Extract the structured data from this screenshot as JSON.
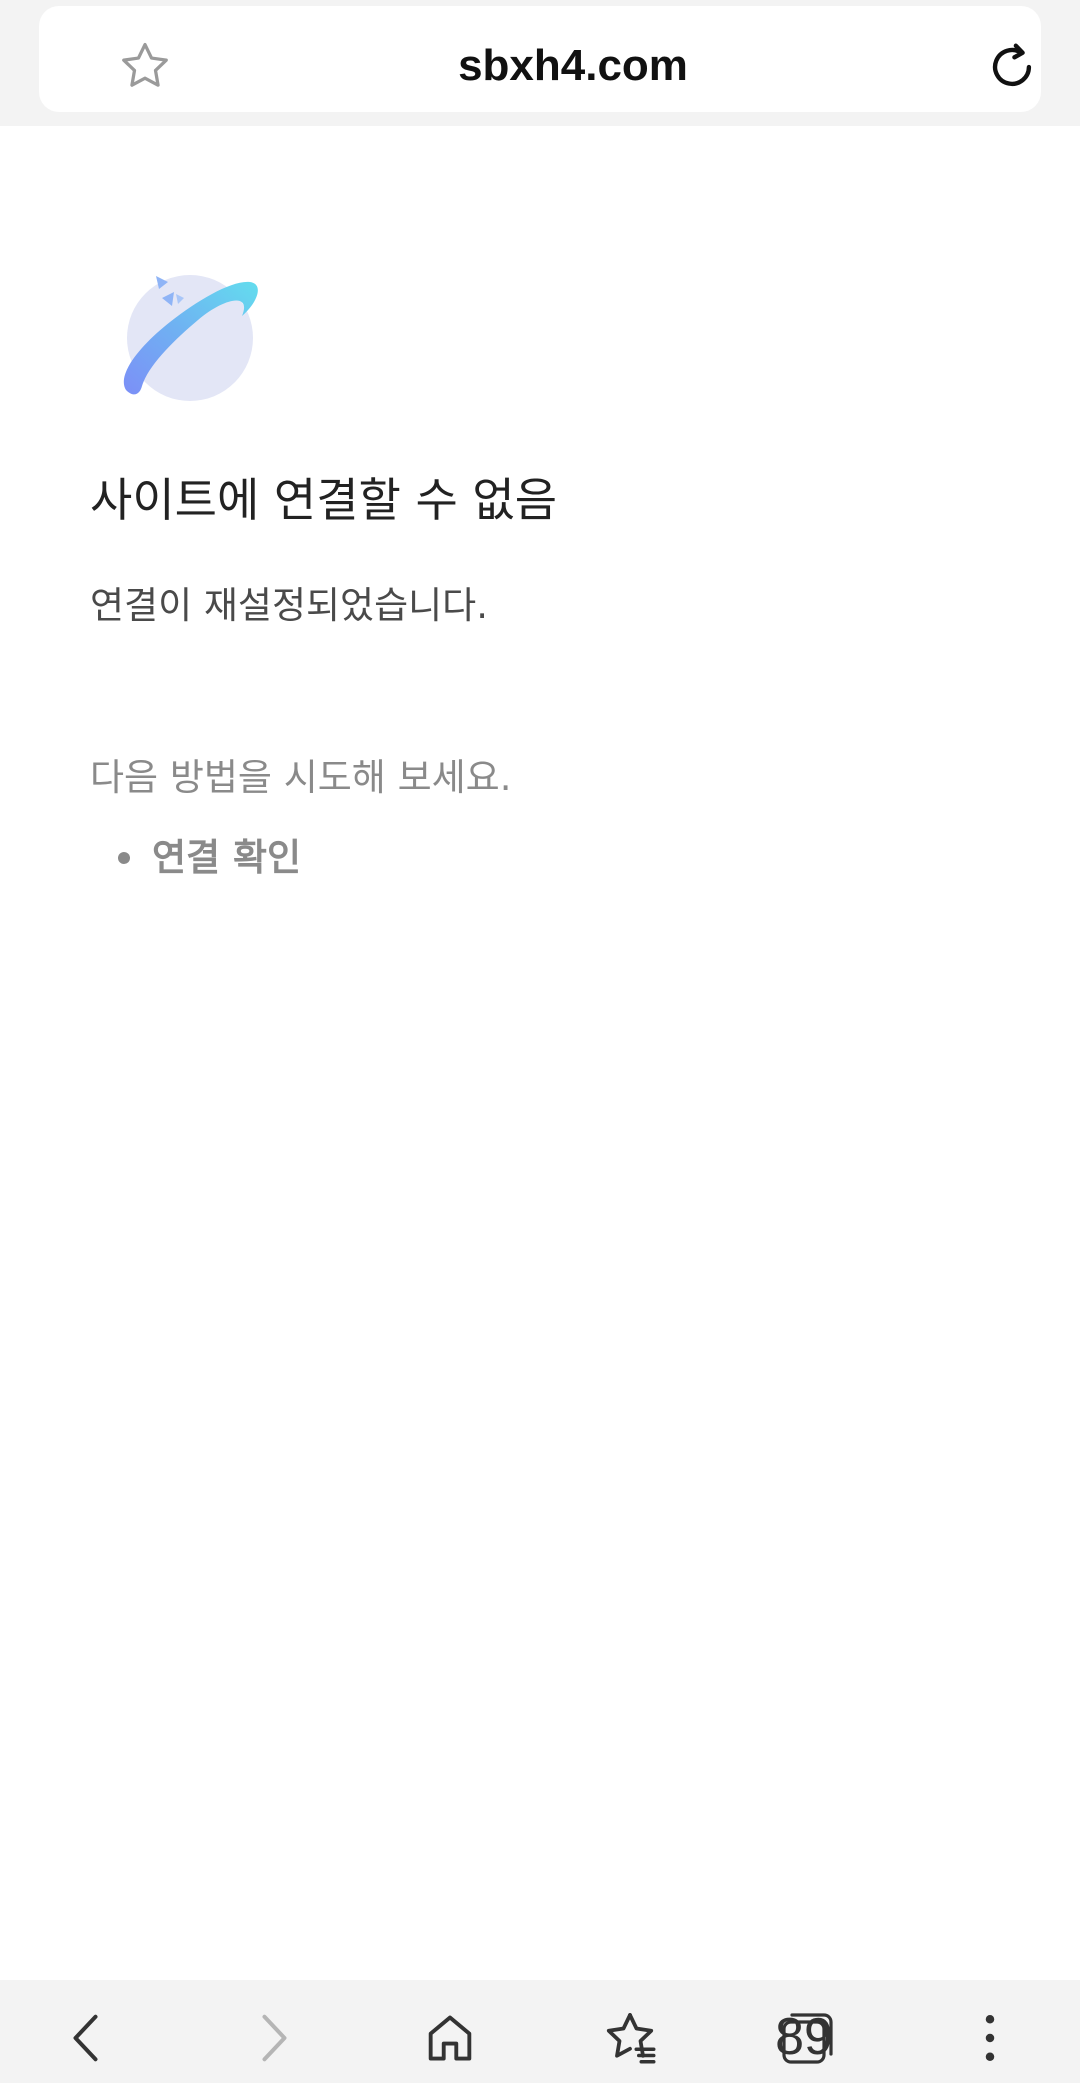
{
  "address_bar": {
    "url": "sbxh4.com",
    "bookmark_icon": "star-outline-icon",
    "reload_icon": "reload-icon"
  },
  "error_page": {
    "illustration_icon": "planet-icon",
    "title": "사이트에 연결할 수 없음",
    "detail": "연결이 재설정되었습니다.",
    "suggestion_heading": "다음 방법을 시도해 보세요.",
    "suggestions": [
      {
        "label": "연결 확인"
      }
    ]
  },
  "toolbar": {
    "back_icon": "chevron-left-icon",
    "forward_icon": "chevron-right-icon",
    "home_icon": "home-icon",
    "bookmarks_icon": "star-list-icon",
    "tabs_icon": "tabs-icon",
    "tabs_count": "89",
    "menu_icon": "more-vertical-icon"
  },
  "colors": {
    "bar_background": "#f3f3f3",
    "title_text": "#222222",
    "secondary_text": "#8a8a8a",
    "disabled_icon": "#b5b5b5",
    "icon": "#333333"
  }
}
